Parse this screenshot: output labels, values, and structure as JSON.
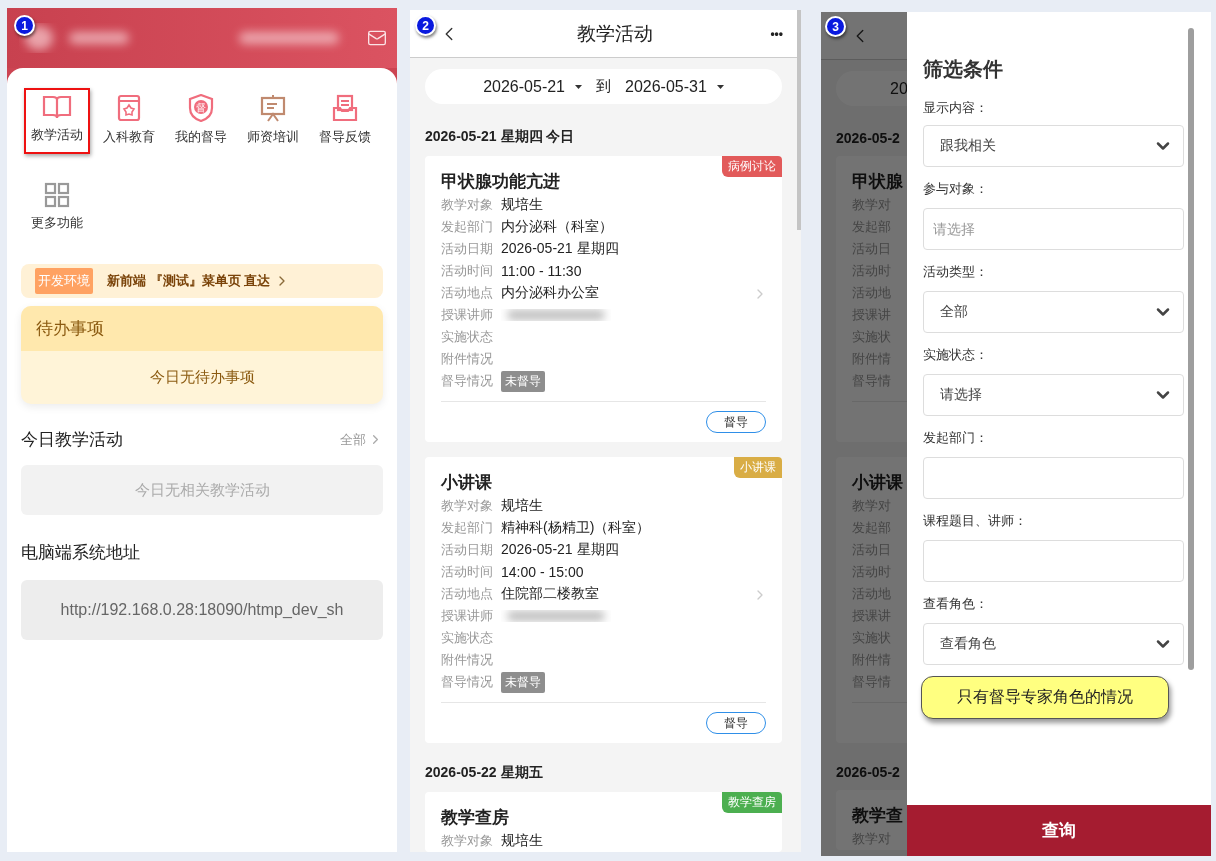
{
  "home": {
    "marker": "1",
    "shortcuts": [
      {
        "label": "教学活动",
        "kind": "book",
        "highlighted": true
      },
      {
        "label": "入科教育",
        "kind": "book-flower",
        "highlighted": false
      },
      {
        "label": "我的督导",
        "kind": "shield",
        "icon_text": "督",
        "highlighted": false
      },
      {
        "label": "师资培训",
        "kind": "easel",
        "highlighted": false
      },
      {
        "label": "督导反馈",
        "kind": "tray",
        "highlighted": false
      },
      {
        "label": "更多功能",
        "kind": "grid",
        "highlighted": false
      }
    ],
    "banner": {
      "tag": "开发环境",
      "text": "新前端 『测试』菜单页 直达"
    },
    "todo": {
      "title": "待办事项",
      "empty": "今日无待办事项"
    },
    "today": {
      "title": "今日教学活动",
      "link": "全部",
      "empty": "今日无相关教学活动"
    },
    "address": {
      "title": "电脑端系统地址",
      "url": "http://192.168.0.28:18090/htmp_dev_sh"
    }
  },
  "activities": {
    "marker": "2",
    "title": "教学活动",
    "more": "•••",
    "range": {
      "from": "2026-05-21",
      "sep": "到",
      "to": "2026-05-31"
    },
    "days": [
      {
        "date": "2026-05-21 星期四 今日",
        "cards": [
          {
            "tag": "病例讨论",
            "color": "#e25a5a",
            "title": "甲状腺功能亢进",
            "button": "督导",
            "rows": [
              {
                "label": "教学对象",
                "kind": "text",
                "value": "规培生"
              },
              {
                "label": "发起部门",
                "kind": "text",
                "value": "内分泌科（科室）"
              },
              {
                "label": "活动日期",
                "kind": "text",
                "value": "2026-05-21 星期四"
              },
              {
                "label": "活动时间",
                "kind": "text",
                "value": "11:00 - 11:30"
              },
              {
                "label": "活动地点",
                "kind": "text",
                "value": "内分泌科办公室"
              },
              {
                "label": "授课讲师",
                "kind": "blurred"
              },
              {
                "label": "实施状态",
                "kind": "empty"
              },
              {
                "label": "附件情况",
                "kind": "empty"
              },
              {
                "label": "督导情况",
                "kind": "status",
                "value": "未督导"
              }
            ]
          },
          {
            "tag": "小讲课",
            "color": "#d9ad45",
            "title": "小讲课",
            "button": "督导",
            "rows": [
              {
                "label": "教学对象",
                "kind": "text",
                "value": "规培生"
              },
              {
                "label": "发起部门",
                "kind": "text",
                "value": "精神科(杨精卫)（科室）"
              },
              {
                "label": "活动日期",
                "kind": "text",
                "value": "2026-05-21 星期四"
              },
              {
                "label": "活动时间",
                "kind": "text",
                "value": "14:00 - 15:00"
              },
              {
                "label": "活动地点",
                "kind": "text",
                "value": "住院部二楼教室"
              },
              {
                "label": "授课讲师",
                "kind": "blurred"
              },
              {
                "label": "实施状态",
                "kind": "empty"
              },
              {
                "label": "附件情况",
                "kind": "empty"
              },
              {
                "label": "督导情况",
                "kind": "status",
                "value": "未督导"
              }
            ]
          }
        ]
      },
      {
        "date": "2026-05-22 星期五",
        "cards": [
          {
            "tag": "教学查房",
            "color": "#4caf50",
            "title": "教学查房",
            "rows": [
              {
                "label": "教学对象",
                "kind": "text",
                "value": "规培生"
              }
            ]
          }
        ]
      }
    ]
  },
  "filter": {
    "marker": "3",
    "backdrop": {
      "range": "20",
      "days": [
        {
          "date": "2026-05-2",
          "cards": [
            {
              "title": "甲状腺",
              "labels": [
                "教学对",
                "发起部",
                "活动日",
                "活动时",
                "活动地",
                "授课讲",
                "实施状",
                "附件情",
                "督导情"
              ]
            },
            {
              "title": "小讲课",
              "labels": [
                "教学对",
                "发起部",
                "活动日",
                "活动时",
                "活动地",
                "授课讲",
                "实施状",
                "附件情",
                "督导情"
              ]
            }
          ]
        },
        {
          "date": "2026-05-2",
          "cards": [
            {
              "title": "教学查",
              "labels": [
                "教学对"
              ]
            }
          ]
        }
      ]
    },
    "title": "筛选条件",
    "fields": [
      {
        "label": "显示内容：",
        "kind": "select",
        "value": "跟我相关"
      },
      {
        "label": "参与对象：",
        "kind": "input",
        "placeholder": "请选择"
      },
      {
        "label": "活动类型：",
        "kind": "select",
        "value": "全部"
      },
      {
        "label": "实施状态：",
        "kind": "select",
        "value": "请选择"
      },
      {
        "label": "发起部门：",
        "kind": "input"
      },
      {
        "label": "课程题目、讲师：",
        "kind": "input"
      },
      {
        "label": "查看角色：",
        "kind": "select",
        "value": "查看角色"
      }
    ],
    "note": "只有督导专家角色的情况",
    "submit": "查询"
  }
}
